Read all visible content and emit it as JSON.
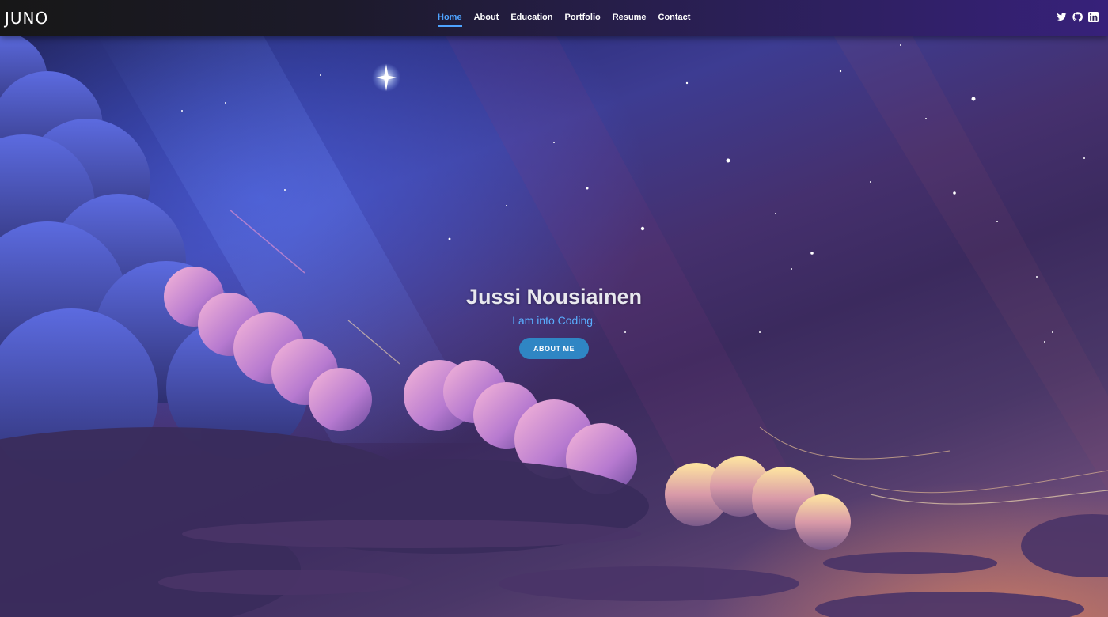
{
  "brand": {
    "logo_text": "JUNO"
  },
  "nav": {
    "items": [
      {
        "label": "Home",
        "active": true
      },
      {
        "label": "About",
        "active": false
      },
      {
        "label": "Education",
        "active": false
      },
      {
        "label": "Portfolio",
        "active": false
      },
      {
        "label": "Resume",
        "active": false
      },
      {
        "label": "Contact",
        "active": false
      }
    ],
    "active_color": "#4ea3ff"
  },
  "social": {
    "icons": [
      "twitter-icon",
      "github-icon",
      "linkedin-icon"
    ]
  },
  "hero": {
    "name": "Jussi Nousiainen",
    "tagline": "I am into Coding.",
    "button_label": "ABOUT ME",
    "tagline_color": "#5aaeff",
    "button_color": "#2f86c4"
  },
  "colors": {
    "navbar_start": "#171717",
    "navbar_end": "#37217a"
  }
}
